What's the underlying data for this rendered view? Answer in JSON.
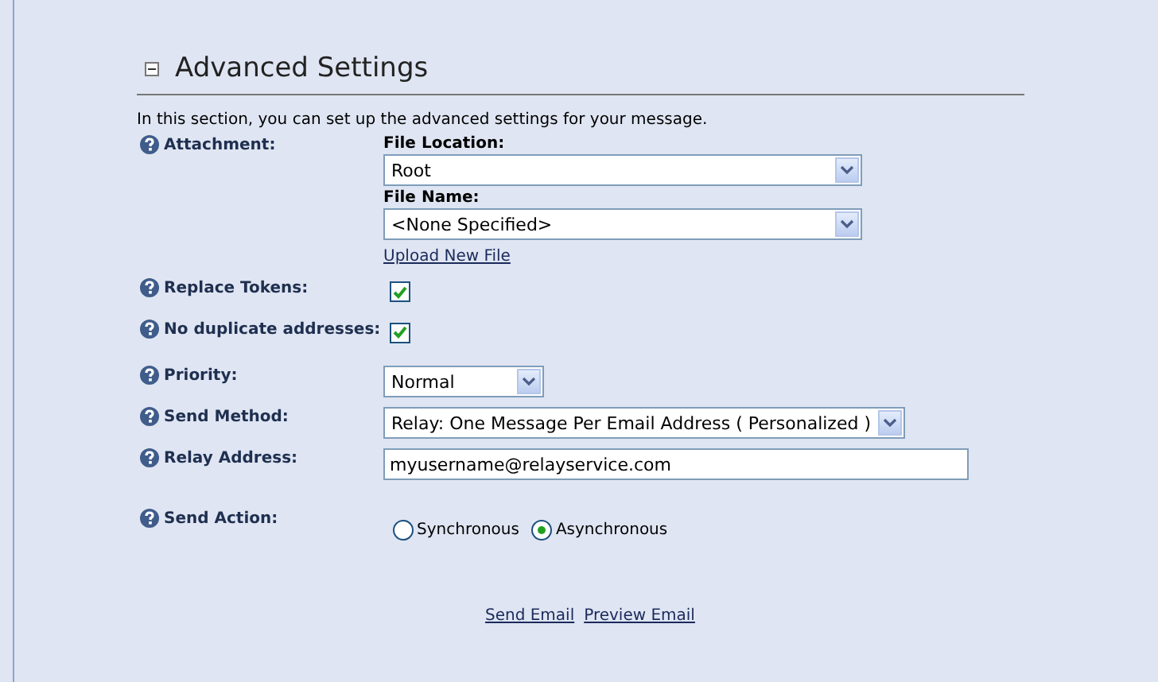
{
  "section": {
    "title": "Advanced Settings",
    "expanded": true,
    "intro": "In this section, you can set up the advanced settings for your message."
  },
  "attachment": {
    "label": "Attachment:",
    "location_label": "File Location:",
    "location_value": "Root",
    "name_label": "File Name:",
    "name_value": "<None Specified>",
    "upload_link": "Upload New File"
  },
  "rows": [
    {
      "kind": "checkbox",
      "label": "Replace Tokens:",
      "checked": true
    },
    {
      "kind": "checkbox",
      "label": "No duplicate addresses:",
      "checked": true
    },
    {
      "kind": "select",
      "label": "Priority:",
      "value": "Normal"
    },
    {
      "kind": "select",
      "label": "Send Method:",
      "value": "Relay: One Message Per Email Address ( Personalized )"
    },
    {
      "kind": "text",
      "label": "Relay Address:",
      "value": "myusername@relayservice.com"
    },
    {
      "kind": "radio",
      "label": "Send Action:",
      "options": [
        {
          "label": "Synchronous",
          "selected": false
        },
        {
          "label": "Asynchronous",
          "selected": true
        }
      ]
    }
  ],
  "links": [
    "Send Email",
    "Preview Email"
  ]
}
